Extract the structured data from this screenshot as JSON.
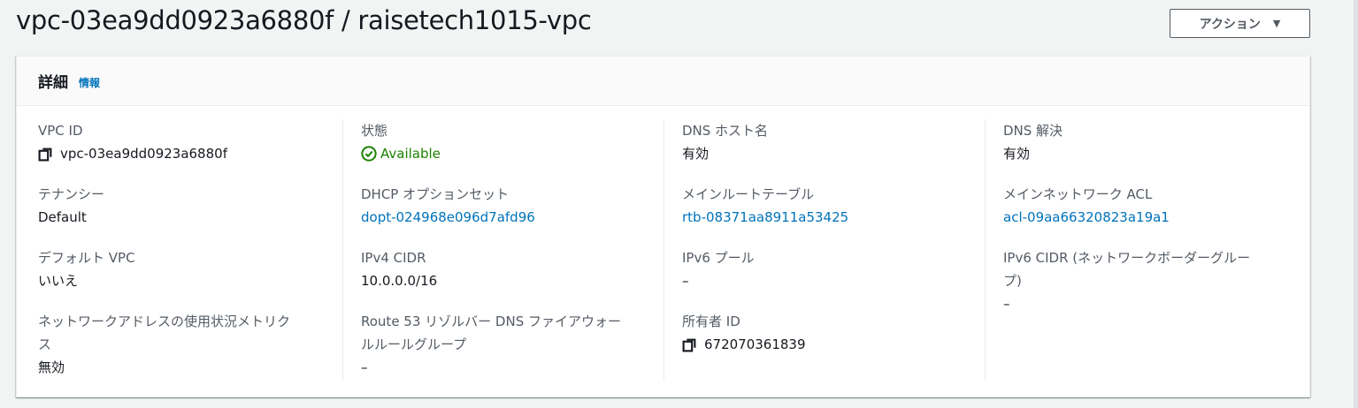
{
  "header": {
    "title": "vpc-03ea9dd0923a6880f / raisetech1015-vpc",
    "action_label": "アクション",
    "action_caret": "▼"
  },
  "panel": {
    "title": "詳細",
    "info": "情報"
  },
  "details": {
    "vpc_id": {
      "label": "VPC ID",
      "value": "vpc-03ea9dd0923a6880f"
    },
    "tenancy": {
      "label": "テナンシー",
      "value": "Default"
    },
    "default_vpc": {
      "label": "デフォルト VPC",
      "value": "いいえ"
    },
    "metrics": {
      "label_1": "ネットワークアドレスの使用状況メトリク",
      "label_2": "ス",
      "value": "無効"
    },
    "state": {
      "label": "状態",
      "value": "Available"
    },
    "dhcp": {
      "label": "DHCP オプションセット",
      "value": "dopt-024968e096d7afd96"
    },
    "ipv4": {
      "label": "IPv4 CIDR",
      "value": "10.0.0.0/16"
    },
    "route53": {
      "label_1": "Route 53 リゾルバー DNS ファイアウォー",
      "label_2": "ルルールグループ",
      "value": "–"
    },
    "dns_hostname": {
      "label": "DNS ホスト名",
      "value": "有効"
    },
    "route_table": {
      "label": "メインルートテーブル",
      "value": "rtb-08371aa8911a53425"
    },
    "ipv6_pool": {
      "label": "IPv6 プール",
      "value": "–"
    },
    "owner": {
      "label": "所有者 ID",
      "value": "672070361839"
    },
    "dns_resolution": {
      "label": "DNS 解決",
      "value": "有効"
    },
    "acl": {
      "label": "メインネットワーク ACL",
      "value": "acl-09aa66320823a19a1"
    },
    "ipv6_cidr": {
      "label_1": "IPv6 CIDR (ネットワークボーダーグルー",
      "label_2": "プ)",
      "value": "–"
    }
  },
  "colors": {
    "link": "#0073bb",
    "success": "#1d8102",
    "text": "#16191f",
    "label": "#545b64"
  },
  "icons": {
    "copy": "copy-icon",
    "status_ok": "check-circle-icon"
  }
}
